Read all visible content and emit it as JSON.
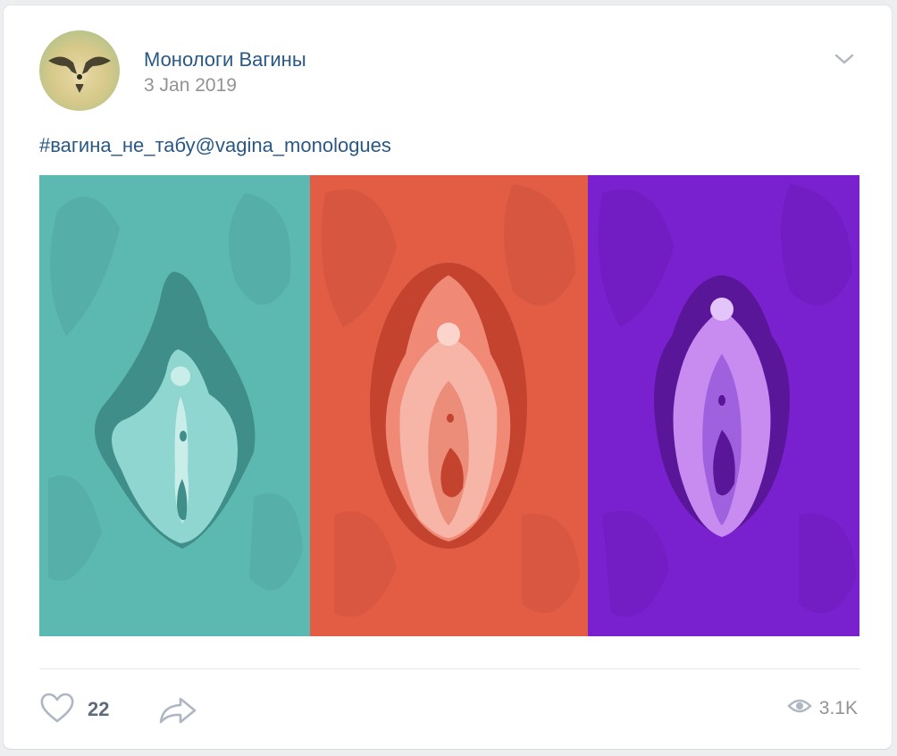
{
  "post": {
    "author": "Монологи Вагины",
    "date": "3 Jan 2019",
    "text": "#вагина_не_табу@vagina_monologues",
    "image": {
      "panels": [
        {
          "name": "teal-panel",
          "color": "#5bb9b2"
        },
        {
          "name": "coral-panel",
          "color": "#e25d44"
        },
        {
          "name": "purple-panel",
          "color": "#7a21cf"
        }
      ]
    },
    "likes": "22",
    "views": "3.1K"
  },
  "colors": {
    "link": "#2a5885",
    "muted": "#939393",
    "icon": "#aeb7c2"
  },
  "icons": {
    "menu": "chevron-down-icon",
    "like": "heart-icon",
    "share": "share-arrow-icon",
    "views": "eye-icon"
  }
}
